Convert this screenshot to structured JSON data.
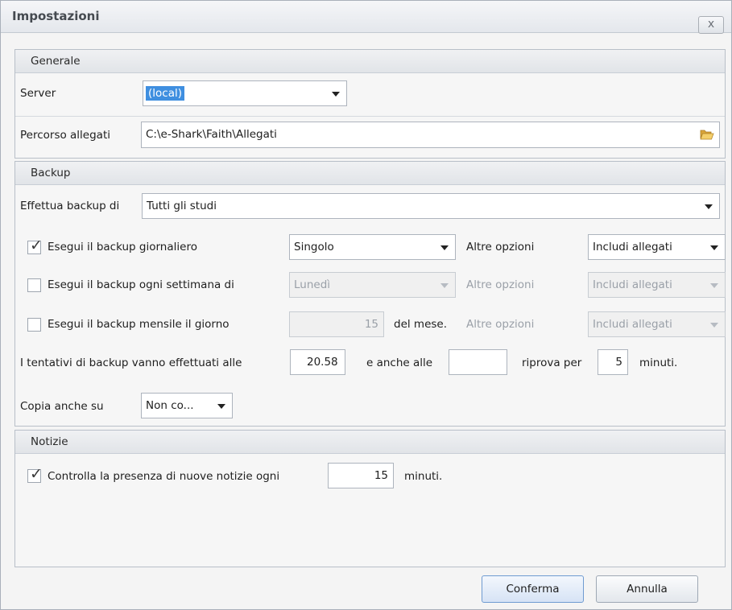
{
  "window": {
    "title": "Impostazioni",
    "close_label": "x"
  },
  "generale": {
    "header": "Generale",
    "server_label": "Server",
    "server_value": "(local)",
    "percorso_label": "Percorso allegati",
    "percorso_value": "C:\\e-Shark\\Faith\\Allegati",
    "folder_icon": "folder-open-icon"
  },
  "backup": {
    "header": "Backup",
    "effettua_label": "Effettua backup di",
    "effettua_value": "Tutti gli studi",
    "daily": {
      "label": "Esegui il backup giornaliero",
      "checked": true,
      "mode": "Singolo",
      "altre_label": "Altre opzioni",
      "altre_value": "Includi allegati"
    },
    "weekly": {
      "label": "Esegui il backup ogni settimana di",
      "checked": false,
      "day": "Lunedì",
      "altre_label": "Altre opzioni",
      "altre_value": "Includi allegati"
    },
    "monthly": {
      "label": "Esegui il backup mensile il giorno",
      "checked": false,
      "day": "15",
      "suffix": "del mese.",
      "altre_label": "Altre opzioni",
      "altre_value": "Includi allegati"
    },
    "tentativi_label": "I tentativi di backup vanno effettuati alle",
    "tentativi_time": "20.58",
    "anche_label": "e anche alle",
    "anche_value": "",
    "riprova_label": "riprova per",
    "riprova_value": "5",
    "minuti_label": "minuti.",
    "copia_label": "Copia anche su",
    "copia_value": "Non co..."
  },
  "notizie": {
    "header": "Notizie",
    "check_label": "Controlla la presenza di nuove notizie ogni",
    "checked": true,
    "minutes": "15",
    "minuti_label": "minuti."
  },
  "footer": {
    "confirm_label": "Conferma",
    "cancel_label": "Annulla"
  }
}
